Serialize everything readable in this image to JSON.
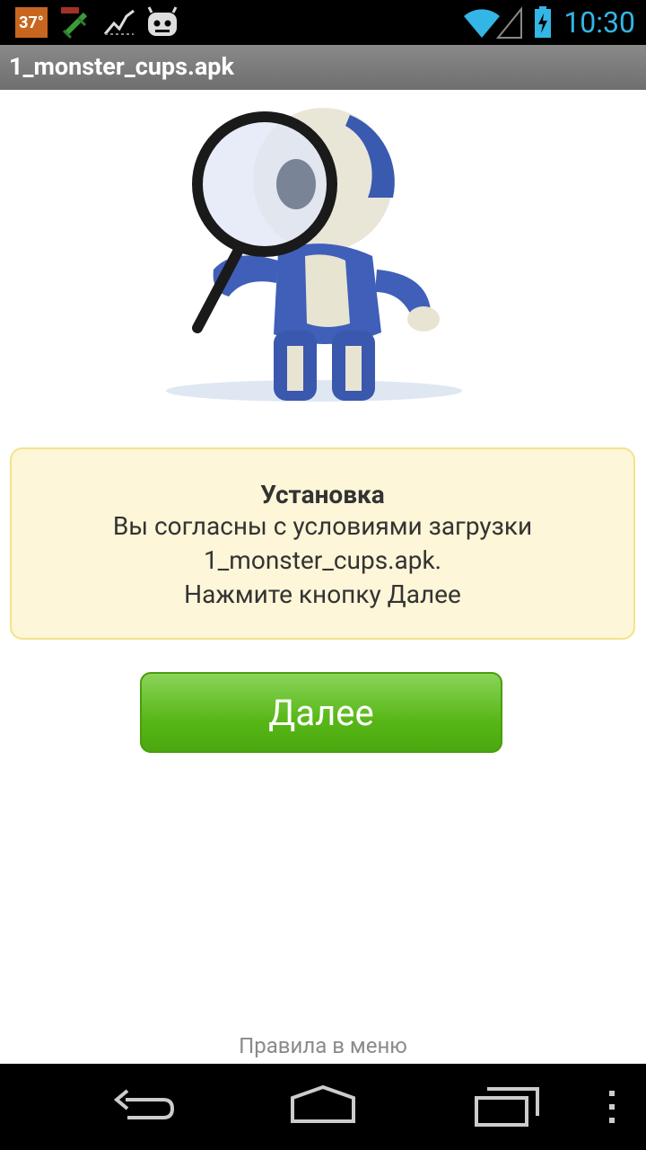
{
  "status_bar": {
    "temperature": "37°",
    "time": "10:30",
    "icons": [
      "fake-signal-icon",
      "activity-graph-icon",
      "cyanogenmod-icon",
      "wifi-icon",
      "cell-signal-icon",
      "battery-charging-icon"
    ]
  },
  "title_bar": {
    "title": "1_monster_cups.apk"
  },
  "hero": {
    "icon": "robot-magnifier-illustration"
  },
  "info_box": {
    "heading": "Установка",
    "line1": "Вы согласны с условиями загрузки",
    "line2": "1_monster_cups.apk.",
    "line3": "Нажмите кнопку Далее"
  },
  "next_button": {
    "label": "Далее"
  },
  "footer": {
    "rules_text": "Правила в меню"
  },
  "colors": {
    "accent": "#33b5e5",
    "button_green": "#58b717",
    "info_bg": "#fdf6d8"
  },
  "nav_bar": {
    "icons": [
      "back-icon",
      "home-icon",
      "recent-apps-icon",
      "overflow-menu-icon"
    ]
  }
}
